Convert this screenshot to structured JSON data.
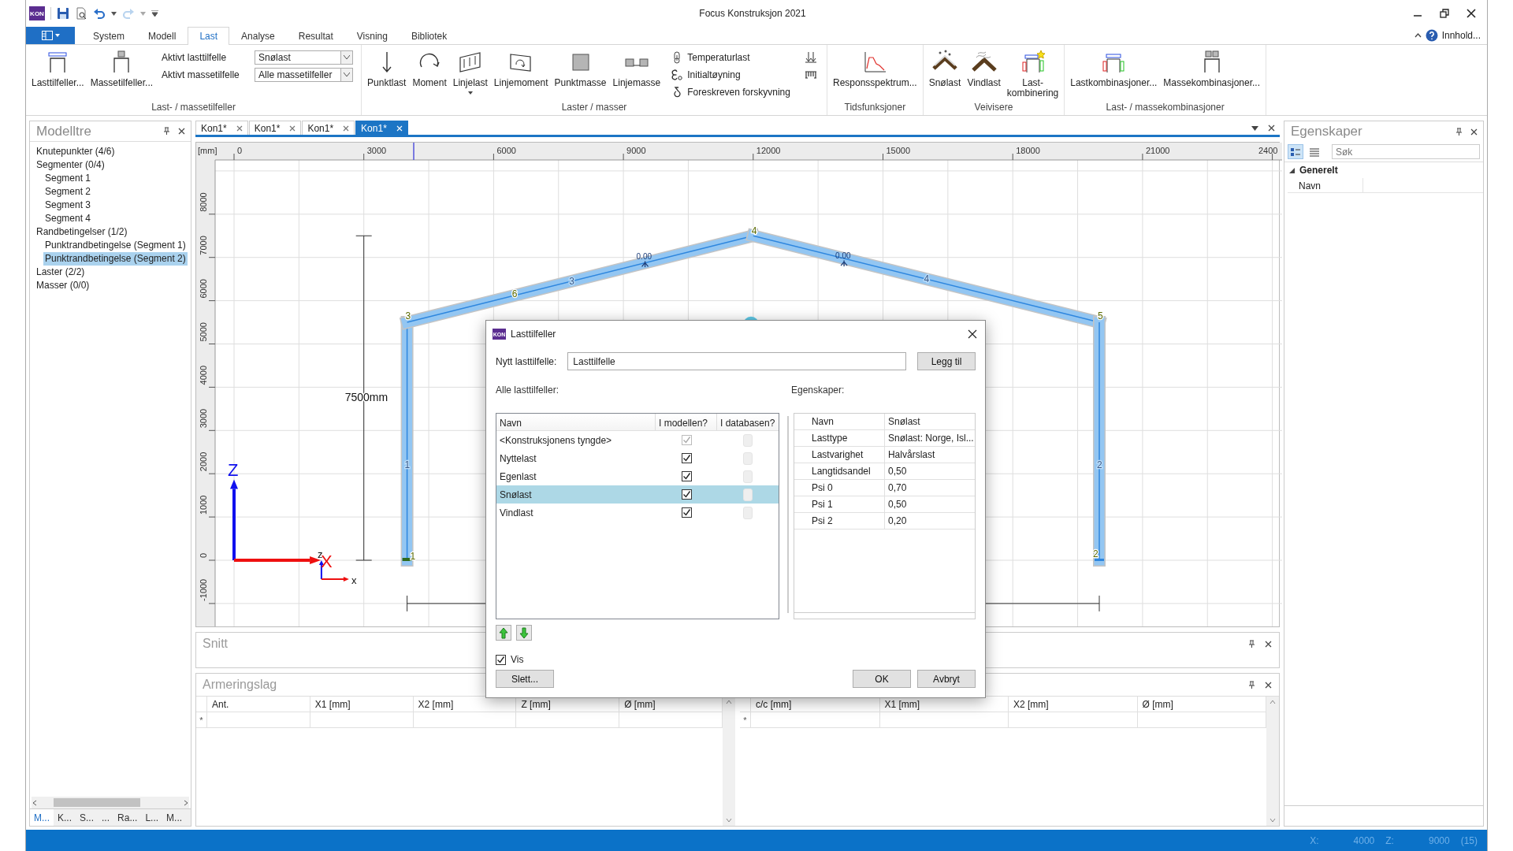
{
  "window": {
    "title": "Focus Konstruksjon 2021",
    "badge": "KON"
  },
  "ribbon": {
    "tabs": [
      {
        "label": "System",
        "selected": false
      },
      {
        "label": "Modell",
        "selected": false
      },
      {
        "label": "Last",
        "selected": true
      },
      {
        "label": "Analyse",
        "selected": false
      },
      {
        "label": "Resultat",
        "selected": false
      },
      {
        "label": "Visning",
        "selected": false
      },
      {
        "label": "Bibliotek",
        "selected": false
      }
    ],
    "help_label": "Innhold...",
    "groups": [
      {
        "label": "Last- / massetilfeller",
        "buttons": [
          {
            "kind": "large",
            "label": "Lasttilfeller...",
            "dropdown": false
          },
          {
            "kind": "large",
            "label": "Massetilfeller...",
            "dropdown": false
          },
          {
            "kind": "combo",
            "label": "Aktivt lasttilfelle",
            "value": "Snølast"
          },
          {
            "kind": "combo",
            "label": "Aktivt massetilfelle",
            "value": "Alle massetilfeller"
          }
        ]
      },
      {
        "label": "Laster / masser",
        "buttons": [
          {
            "kind": "large",
            "label": "Punktlast",
            "dropdown": false
          },
          {
            "kind": "large",
            "label": "Moment",
            "dropdown": false
          },
          {
            "kind": "large",
            "label": "Linjelast",
            "dropdown": true
          },
          {
            "kind": "large",
            "label": "Linjemoment",
            "dropdown": false
          },
          {
            "kind": "large",
            "label": "Punktmasse",
            "dropdown": false
          },
          {
            "kind": "large",
            "label": "Linjemasse",
            "dropdown": false
          },
          {
            "kind": "small",
            "label": "Temperaturlast"
          },
          {
            "kind": "small",
            "label": "Initialtøyning"
          },
          {
            "kind": "small",
            "label": "Foreskreven forskyvning"
          },
          {
            "kind": "icon"
          },
          {
            "kind": "icon"
          }
        ]
      },
      {
        "label": "Tidsfunksjoner",
        "buttons": [
          {
            "kind": "large",
            "label": "Responsspektrum...",
            "dropdown": false
          }
        ]
      },
      {
        "label": "Veivisere",
        "buttons": [
          {
            "kind": "large",
            "label": "Snølast",
            "dropdown": false
          },
          {
            "kind": "large",
            "label": "Vindlast",
            "dropdown": false
          },
          {
            "kind": "large",
            "label": "Last-\nkombinering",
            "dropdown": false
          }
        ]
      },
      {
        "label": "Last- / massekombinasjoner",
        "buttons": [
          {
            "kind": "large",
            "label": "Lastkombinasjoner...",
            "dropdown": false
          },
          {
            "kind": "large",
            "label": "Massekombinasjoner...",
            "dropdown": false
          }
        ]
      }
    ]
  },
  "model_tree": {
    "title": "Modelltre",
    "items": [
      {
        "label": "Knutepunkter (4/6)",
        "selected": false
      },
      {
        "label": "Segmenter (0/4)",
        "selected": false,
        "children": [
          {
            "label": "Segment 1",
            "selected": false
          },
          {
            "label": "Segment 2",
            "selected": false
          },
          {
            "label": "Segment 3",
            "selected": false
          },
          {
            "label": "Segment 4",
            "selected": false
          }
        ]
      },
      {
        "label": "Randbetingelser (1/2)",
        "selected": false,
        "children": [
          {
            "label": "Punktrandbetingelse (Segment 1)",
            "selected": false
          },
          {
            "label": "Punktrandbetingelse (Segment 2)",
            "selected": true
          }
        ]
      },
      {
        "label": "Laster (2/2)",
        "selected": false
      },
      {
        "label": "Masser (0/0)",
        "selected": false
      }
    ],
    "bottom_tabs": [
      {
        "label": "M...",
        "selected": true
      },
      {
        "label": "K...",
        "selected": false
      },
      {
        "label": "S...",
        "selected": false
      },
      {
        "label": "...",
        "selected": false
      },
      {
        "label": "Ra...",
        "selected": false
      },
      {
        "label": "L...",
        "selected": false
      },
      {
        "label": "M...",
        "selected": false
      }
    ]
  },
  "doc_tabs": [
    {
      "label": "Kon1*",
      "selected": false
    },
    {
      "label": "Kon1*",
      "selected": false
    },
    {
      "label": "Kon1*",
      "selected": false
    },
    {
      "label": "Kon1*",
      "selected": true
    }
  ],
  "canvas": {
    "unit_label": "[mm]",
    "x_ruler": [
      "0",
      "3000",
      "6000",
      "9000",
      "12000",
      "15000",
      "18000",
      "21000",
      "2400"
    ],
    "y_ruler": [
      "-1000",
      "0",
      "1000",
      "2000",
      "3000",
      "4000",
      "5000",
      "6000",
      "7000",
      "8000"
    ],
    "node_labels": [
      "1",
      "2",
      "3",
      "4",
      "5",
      "6"
    ],
    "member_labels": [
      "1",
      "2",
      "3",
      "4"
    ],
    "load_labels": [
      "0.00",
      "0.00"
    ],
    "dimension": "7500mm",
    "axis_labels": [
      "Z",
      "X",
      "z",
      "x"
    ]
  },
  "section_panel": {
    "title": "Snitt"
  },
  "reinforcement_panel": {
    "title": "Armeringslag",
    "tables": [
      {
        "columns": [
          "Ant.",
          "X1 [mm]",
          "X2 [mm]",
          "Z [mm]",
          "Ø [mm]"
        ],
        "new_row_marker": "*"
      },
      {
        "columns": [
          "c/c [mm]",
          "X1 [mm]",
          "X2 [mm]",
          "Ø [mm]"
        ],
        "new_row_marker": "*"
      }
    ]
  },
  "properties_panel": {
    "title": "Egenskaper",
    "search_placeholder": "Søk",
    "categories": [
      {
        "label": "Generelt",
        "expanded": true,
        "rows": [
          {
            "name": "Navn"
          }
        ]
      }
    ]
  },
  "status_bar": {
    "x_label": "X:",
    "x_value": "4000",
    "z_label": "Z:",
    "z_value": "9000",
    "count": "(15)"
  },
  "dialog": {
    "title": "Lasttilfeller",
    "badge": "KON",
    "new_label": "Nytt lasttilfelle:",
    "new_value": "Lasttilfelle",
    "add_button": "Legg til",
    "list_label": "Alle lasttilfeller:",
    "props_label": "Egenskaper:",
    "columns": [
      "Navn",
      "I modellen?",
      "I databasen?"
    ],
    "load_cases": [
      {
        "name": "<Konstruksjonens tyngde>",
        "in_model": true,
        "disabled": true,
        "in_database": false,
        "selected": false
      },
      {
        "name": "Nyttelast",
        "in_model": true,
        "disabled": false,
        "in_database": false,
        "selected": false
      },
      {
        "name": "Egenlast",
        "in_model": true,
        "disabled": false,
        "in_database": false,
        "selected": false
      },
      {
        "name": "Snølast",
        "in_model": true,
        "disabled": false,
        "in_database": false,
        "selected": true
      },
      {
        "name": "Vindlast",
        "in_model": true,
        "disabled": false,
        "in_database": false,
        "selected": false
      }
    ],
    "properties": [
      {
        "name": "Navn",
        "value": "Snølast"
      },
      {
        "name": "Lasttype",
        "value": "Snølast: Norge, Isl..."
      },
      {
        "name": "Lastvarighet",
        "value": "Halvårslast"
      },
      {
        "name": "Langtidsandel",
        "value": "0,50"
      },
      {
        "name": "Psi 0",
        "value": "0,70"
      },
      {
        "name": "Psi 1",
        "value": "0,50"
      },
      {
        "name": "Psi 2",
        "value": "0,20"
      }
    ],
    "show_label": "Vis",
    "show": true,
    "buttons": [
      {
        "kind": "left",
        "label": "Slett..."
      },
      {
        "kind": "right",
        "label": "OK"
      },
      {
        "kind": "right",
        "label": "Avbryt"
      }
    ]
  }
}
